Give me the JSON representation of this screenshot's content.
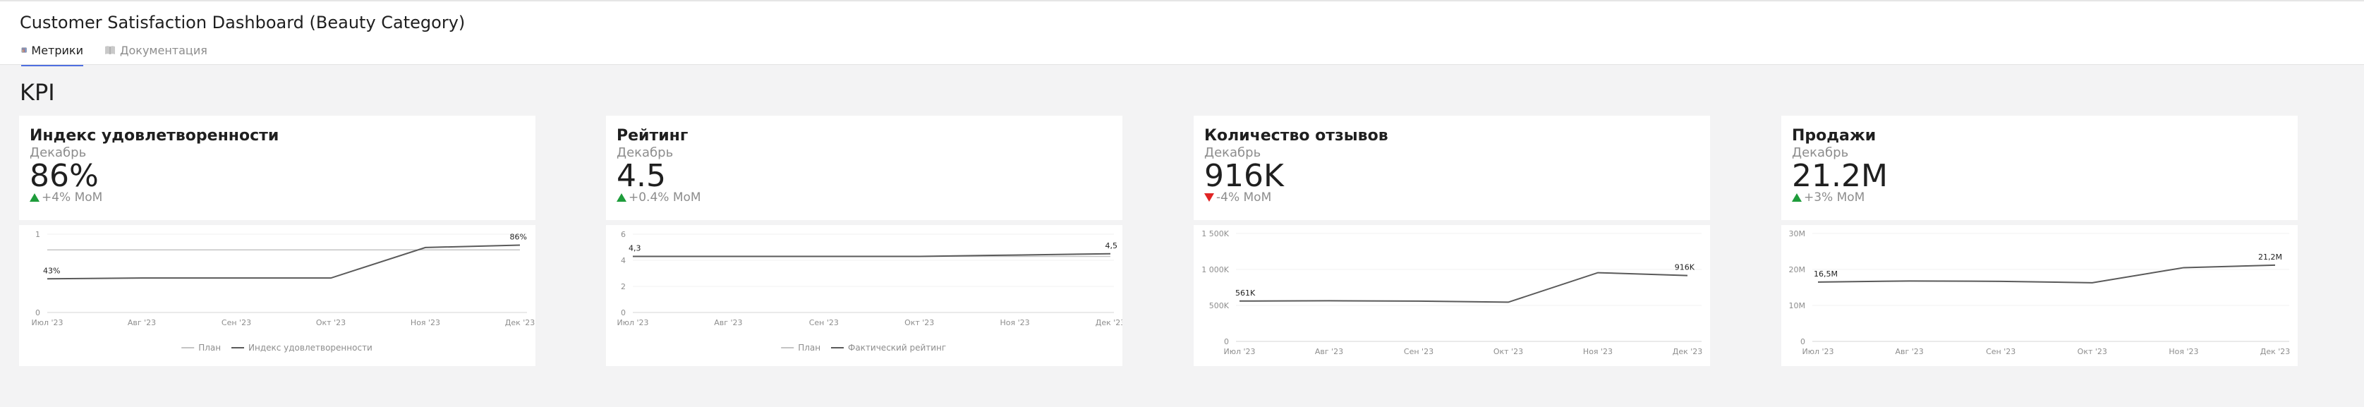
{
  "header": {
    "title": "Customer Satisfaction Dashboard (Beauty Category)",
    "tabs": [
      {
        "label": "Метрики",
        "icon": "chart-icon",
        "active": true
      },
      {
        "label": "Документация",
        "icon": "book-icon",
        "active": false
      }
    ]
  },
  "section": {
    "title": "KPI"
  },
  "colors": {
    "accent": "#4f6fe0",
    "up": "#1e9c3b",
    "down": "#e02424",
    "line": "#5a5a5a",
    "plan": "#c4c4c4"
  },
  "kpis": [
    {
      "name": "Индекс удовлетворенности",
      "month": "Декабрь",
      "value": "86%",
      "change": "+4% MoM",
      "direction": "up"
    },
    {
      "name": "Рейтинг",
      "month": "Декабрь",
      "value": "4.5",
      "change": "+0.4% MoM",
      "direction": "up"
    },
    {
      "name": "Количество отзывов",
      "month": "Декабрь",
      "value": "916K",
      "change": "-4% MoM",
      "direction": "down"
    },
    {
      "name": "Продажи",
      "month": "Декабрь",
      "value": "21.2M",
      "change": "+3% MoM",
      "direction": "up"
    }
  ],
  "chart_data": [
    {
      "type": "line",
      "x": [
        "Июл '23",
        "Авг '23",
        "Сен '23",
        "Окт '23",
        "Ноя '23",
        "Дек '23"
      ],
      "ylim": [
        0,
        1
      ],
      "yticks": [
        0,
        1
      ],
      "ytick_labels": [
        "0",
        "1"
      ],
      "series": [
        {
          "name": "План",
          "values": [
            0.8,
            0.8,
            0.8,
            0.8,
            0.8,
            0.8
          ],
          "color": "#c4c4c4"
        },
        {
          "name": "Индекс удовлетворенности",
          "values": [
            0.43,
            0.44,
            0.44,
            0.44,
            0.83,
            0.86
          ],
          "color": "#5a5a5a"
        }
      ],
      "data_labels": [
        {
          "index": 0,
          "text": "43%"
        },
        {
          "index": 5,
          "text": "86%"
        }
      ],
      "legend": "bottom"
    },
    {
      "type": "line",
      "x": [
        "Июл '23",
        "Авг '23",
        "Сен '23",
        "Окт '23",
        "Ноя '23",
        "Дек '23"
      ],
      "ylim": [
        0,
        6
      ],
      "yticks": [
        0,
        2,
        4,
        6
      ],
      "ytick_labels": [
        "0",
        "2",
        "4",
        "6"
      ],
      "series": [
        {
          "name": "План",
          "values": [
            4.3,
            4.3,
            4.3,
            4.3,
            4.3,
            4.3
          ],
          "color": "#c4c4c4"
        },
        {
          "name": "Фактический рейтинг",
          "values": [
            4.3,
            4.3,
            4.3,
            4.3,
            4.4,
            4.5
          ],
          "color": "#5a5a5a"
        }
      ],
      "data_labels": [
        {
          "index": 0,
          "text": "4,3"
        },
        {
          "index": 5,
          "text": "4,5"
        }
      ],
      "legend": "bottom"
    },
    {
      "type": "line",
      "x": [
        "Июл '23",
        "Авг '23",
        "Сен '23",
        "Окт '23",
        "Ноя '23",
        "Дек '23"
      ],
      "ylim": [
        0,
        1500000
      ],
      "yticks": [
        0,
        500000,
        1000000,
        1500000
      ],
      "ytick_labels": [
        "0",
        "500K",
        "1 000K",
        "1 500K"
      ],
      "series": [
        {
          "values": [
            561000,
            565000,
            560000,
            545000,
            955000,
            916000
          ],
          "color": "#5a5a5a"
        }
      ],
      "data_labels": [
        {
          "index": 0,
          "text": "561K"
        },
        {
          "index": 5,
          "text": "916K"
        }
      ],
      "legend": "none"
    },
    {
      "type": "line",
      "x": [
        "Июл '23",
        "Авг '23",
        "Сен '23",
        "Окт '23",
        "Ноя '23",
        "Дек '23"
      ],
      "ylim": [
        0,
        30000000
      ],
      "yticks": [
        0,
        10000000,
        20000000,
        30000000
      ],
      "ytick_labels": [
        "0",
        "10M",
        "20M",
        "30M"
      ],
      "series": [
        {
          "values": [
            16500000,
            16800000,
            16700000,
            16300000,
            20500000,
            21200000
          ],
          "color": "#5a5a5a"
        }
      ],
      "data_labels": [
        {
          "index": 0,
          "text": "16,5M"
        },
        {
          "index": 5,
          "text": "21,2M"
        }
      ],
      "legend": "none"
    }
  ]
}
